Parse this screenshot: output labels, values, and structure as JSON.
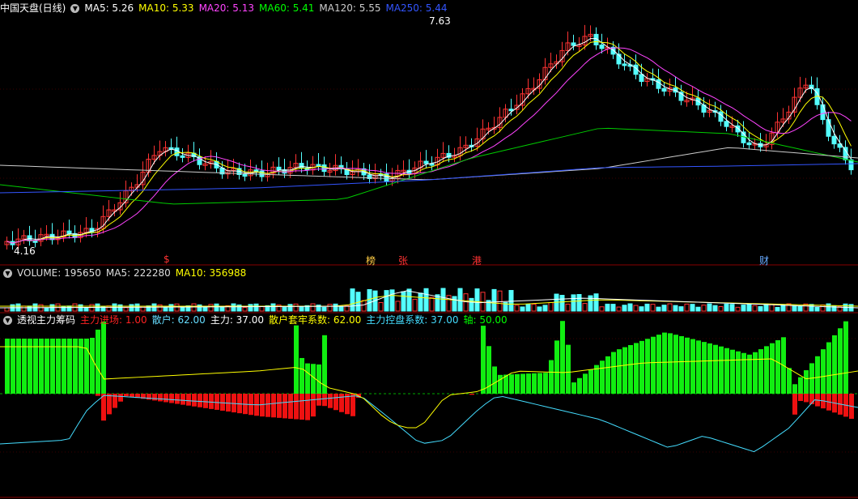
{
  "main_legend": {
    "title": "中国天盘(日线)",
    "items": [
      {
        "text": "MA5: 5.26",
        "color": "#ffffff"
      },
      {
        "text": "MA10: 5.33",
        "color": "#ffff00"
      },
      {
        "text": "MA20: 5.13",
        "color": "#ff44ff"
      },
      {
        "text": "MA60: 5.41",
        "color": "#00ff00"
      },
      {
        "text": "MA120: 5.55",
        "color": "#cccccc"
      },
      {
        "text": "MA250: 5.44",
        "color": "#3355ff"
      }
    ]
  },
  "price_labels": {
    "high": "7.63",
    "low": "4.16"
  },
  "events": [
    {
      "text": "$",
      "color": "#ff3333"
    },
    {
      "text": "榜",
      "color": "#ffcc44"
    },
    {
      "text": "张",
      "color": "#ff3333"
    },
    {
      "text": "港",
      "color": "#ff3333"
    },
    {
      "text": "财",
      "color": "#66aaff"
    }
  ],
  "volume_legend": {
    "items": [
      {
        "text": "VOLUME: 195650",
        "color": "#dddddd"
      },
      {
        "text": "MA5: 222280",
        "color": "#dddddd"
      },
      {
        "text": "MA10: 356988",
        "color": "#ffff00"
      }
    ]
  },
  "indicator_legend": {
    "title": "透视主力筹码",
    "items": [
      {
        "text": "主力进场: 1.00",
        "color": "#ff2222"
      },
      {
        "text": "散户: 62.00",
        "color": "#66ddff"
      },
      {
        "text": "主力: 37.00",
        "color": "#ffffff"
      },
      {
        "text": "散户套牢系数: 62.00",
        "color": "#ffff00"
      },
      {
        "text": "主力控盘系数: 37.00",
        "color": "#44ddff"
      },
      {
        "text": "轴: 50.00",
        "color": "#00ff00"
      }
    ]
  },
  "colors": {
    "up": "#ff3333",
    "down": "#54ffff",
    "bg": "#000000"
  }
}
